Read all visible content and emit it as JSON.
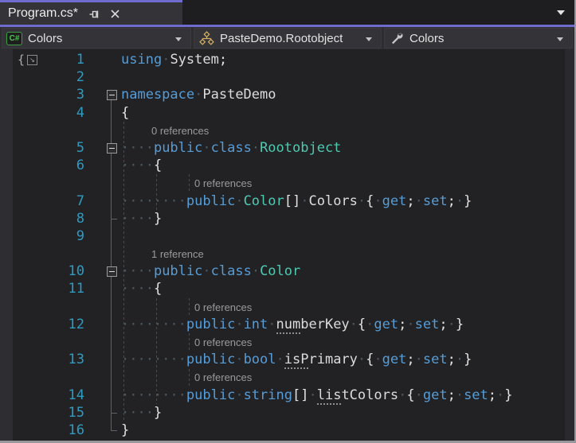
{
  "tab_bar": {
    "tab": {
      "title": "Program.cs*",
      "modified": true
    },
    "icons": [
      "pin-icon",
      "close-icon",
      "tab-list-chevron-icon"
    ]
  },
  "nav_bar": {
    "project": {
      "label": "Colors",
      "icon": "csharp-project-icon"
    },
    "type": {
      "label": "PasteDemo.Rootobject",
      "icon": "class-icon"
    },
    "member": {
      "label": "Colors",
      "icon": "wrench-icon"
    }
  },
  "editor": {
    "rows": [
      {
        "type": "code",
        "line": "1",
        "tokens": [
          [
            "kw",
            "using"
          ],
          [
            "ws",
            "·"
          ],
          [
            "id",
            "System"
          ],
          [
            "pn",
            ";"
          ]
        ]
      },
      {
        "type": "code",
        "line": "2",
        "tokens": []
      },
      {
        "type": "code",
        "line": "3",
        "fold": true,
        "tokens": [
          [
            "kw",
            "namespace"
          ],
          [
            "ws",
            "·"
          ],
          [
            "id",
            "PasteDemo"
          ]
        ]
      },
      {
        "type": "code",
        "line": "4",
        "tokens": [
          [
            "pn",
            "{"
          ]
        ]
      },
      {
        "type": "lens",
        "indent": 4,
        "text": "0 references"
      },
      {
        "type": "code",
        "line": "5",
        "fold": true,
        "tokens": [
          [
            "ws",
            "····"
          ],
          [
            "kw",
            "public"
          ],
          [
            "ws",
            "·"
          ],
          [
            "kw",
            "class"
          ],
          [
            "ws",
            "·"
          ],
          [
            "cls",
            "Rootobject"
          ]
        ]
      },
      {
        "type": "code",
        "line": "6",
        "tokens": [
          [
            "ws",
            "····"
          ],
          [
            "pn",
            "{"
          ]
        ]
      },
      {
        "type": "lens",
        "indent": 8,
        "text": "0 references"
      },
      {
        "type": "code",
        "line": "7",
        "tokens": [
          [
            "ws",
            "········"
          ],
          [
            "kw",
            "public"
          ],
          [
            "ws",
            "·"
          ],
          [
            "cls",
            "Color"
          ],
          [
            "pn",
            "[]"
          ],
          [
            "ws",
            "·"
          ],
          [
            "id",
            "Colors"
          ],
          [
            "ws",
            "·"
          ],
          [
            "pn",
            "{"
          ],
          [
            "ws",
            "·"
          ],
          [
            "kw",
            "get"
          ],
          [
            "pn",
            ";"
          ],
          [
            "ws",
            "·"
          ],
          [
            "kw",
            "set"
          ],
          [
            "pn",
            ";"
          ],
          [
            "ws",
            "·"
          ],
          [
            "pn",
            "}"
          ]
        ]
      },
      {
        "type": "code",
        "line": "8",
        "tokens": [
          [
            "ws",
            "····"
          ],
          [
            "pn",
            "}"
          ]
        ]
      },
      {
        "type": "code",
        "line": "9",
        "tokens": []
      },
      {
        "type": "lens",
        "indent": 4,
        "text": "1 reference"
      },
      {
        "type": "code",
        "line": "10",
        "fold": true,
        "tokens": [
          [
            "ws",
            "····"
          ],
          [
            "kw",
            "public"
          ],
          [
            "ws",
            "·"
          ],
          [
            "kw",
            "class"
          ],
          [
            "ws",
            "·"
          ],
          [
            "cls",
            "Color"
          ]
        ]
      },
      {
        "type": "code",
        "line": "11",
        "tokens": [
          [
            "ws",
            "····"
          ],
          [
            "pn",
            "{"
          ]
        ]
      },
      {
        "type": "lens",
        "indent": 8,
        "text": "0 references"
      },
      {
        "type": "code",
        "line": "12",
        "tokens": [
          [
            "ws",
            "········"
          ],
          [
            "kw",
            "public"
          ],
          [
            "ws",
            "·"
          ],
          [
            "kw",
            "int"
          ],
          [
            "ws",
            "·"
          ],
          [
            "sug",
            "num"
          ],
          [
            "id",
            "berKey"
          ],
          [
            "ws",
            "·"
          ],
          [
            "pn",
            "{"
          ],
          [
            "ws",
            "·"
          ],
          [
            "kw",
            "get"
          ],
          [
            "pn",
            ";"
          ],
          [
            "ws",
            "·"
          ],
          [
            "kw",
            "set"
          ],
          [
            "pn",
            ";"
          ],
          [
            "ws",
            "·"
          ],
          [
            "pn",
            "}"
          ]
        ]
      },
      {
        "type": "lens",
        "indent": 8,
        "text": "0 references"
      },
      {
        "type": "code",
        "line": "13",
        "tokens": [
          [
            "ws",
            "········"
          ],
          [
            "kw",
            "public"
          ],
          [
            "ws",
            "·"
          ],
          [
            "kw",
            "bool"
          ],
          [
            "ws",
            "·"
          ],
          [
            "sug",
            "isP"
          ],
          [
            "id",
            "rimary"
          ],
          [
            "ws",
            "·"
          ],
          [
            "pn",
            "{"
          ],
          [
            "ws",
            "·"
          ],
          [
            "kw",
            "get"
          ],
          [
            "pn",
            ";"
          ],
          [
            "ws",
            "·"
          ],
          [
            "kw",
            "set"
          ],
          [
            "pn",
            ";"
          ],
          [
            "ws",
            "·"
          ],
          [
            "pn",
            "}"
          ]
        ]
      },
      {
        "type": "lens",
        "indent": 8,
        "text": "0 references"
      },
      {
        "type": "code",
        "line": "14",
        "tokens": [
          [
            "ws",
            "········"
          ],
          [
            "kw",
            "public"
          ],
          [
            "ws",
            "·"
          ],
          [
            "kw",
            "string"
          ],
          [
            "pn",
            "[]"
          ],
          [
            "ws",
            "·"
          ],
          [
            "sug",
            "lis"
          ],
          [
            "id",
            "tColors"
          ],
          [
            "ws",
            "·"
          ],
          [
            "pn",
            "{"
          ],
          [
            "ws",
            "·"
          ],
          [
            "kw",
            "get"
          ],
          [
            "pn",
            ";"
          ],
          [
            "ws",
            "·"
          ],
          [
            "kw",
            "set"
          ],
          [
            "pn",
            ";"
          ],
          [
            "ws",
            "·"
          ],
          [
            "pn",
            "}"
          ]
        ]
      },
      {
        "type": "code",
        "line": "15",
        "tokens": [
          [
            "ws",
            "····"
          ],
          [
            "pn",
            "}"
          ]
        ]
      },
      {
        "type": "code",
        "line": "16",
        "tokens": [
          [
            "pn",
            "}"
          ]
        ]
      }
    ],
    "margin_icon": {
      "name": "brace-indicator-icon",
      "glyphs": [
        "{",
        "↘"
      ]
    }
  },
  "colors": {
    "accent_purple": "#706CCE",
    "keyword_blue": "#569CD6",
    "class_teal": "#4EC9B0",
    "identifier": "#DCDCDC",
    "whitespace_dot": "#4A575F",
    "line_number_blue": "#2E9BC1",
    "editor_background": "#222225",
    "codelens_gray": "#9A9A9A",
    "csharp_icon_green": "#4DC353",
    "class_icon_gold": "#D4AF63"
  }
}
